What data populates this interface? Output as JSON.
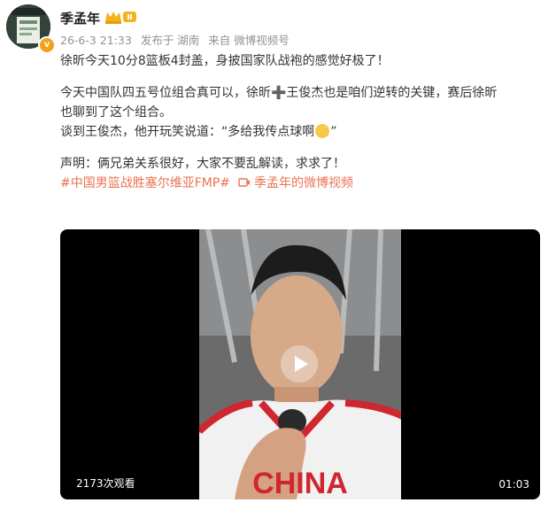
{
  "post": {
    "author": "季孟年",
    "meta": {
      "date": "26-6-3 21:33",
      "published_from": "发布于 湖南",
      "source": "来自 微博视频号"
    },
    "paragraphs": [
      "徐昕今天10分8篮板4封盖，身披国家队战袍的感觉好极了！",
      "今天中国队四五号位组合真可以，徐昕➕王俊杰也是咱们逆转的关键，赛后徐昕",
      "也聊到了这个组合。",
      "谈到王俊杰，他开玩笑说道：“多给我传点球啊",
      "声明：俩兄弟关系很好，大家不要乱解读，求求了！"
    ],
    "hashtags": {
      "topic": "#中国男篮战胜塞尔维亚FMP#",
      "video_link": "季孟年的微博视频"
    },
    "video": {
      "views": "2173次观看",
      "duration": "01:03",
      "jersey_text": "CHINA"
    }
  },
  "colors": {
    "link": "#eb7350",
    "meta": "#939393",
    "jersey_red": "#d0262f"
  }
}
